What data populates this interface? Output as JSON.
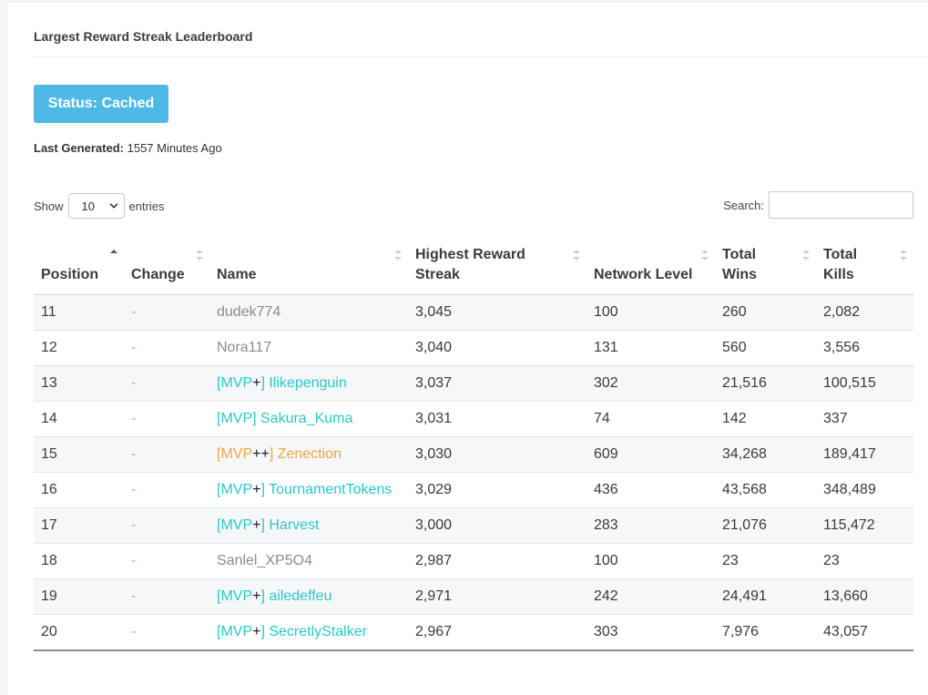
{
  "card": {
    "title": "Largest Reward Streak Leaderboard"
  },
  "status": {
    "label": "Status: Cached"
  },
  "last_generated": {
    "label": "Last Generated:",
    "value": "1557 Minutes Ago"
  },
  "length": {
    "show_label": "Show",
    "selected": "10",
    "entries_label": "entries"
  },
  "search": {
    "label": "Search:",
    "value": "",
    "placeholder": ""
  },
  "table": {
    "columns": [
      "Position",
      "Change",
      "Name",
      "Highest Reward Streak",
      "Network Level",
      "Total Wins",
      "Total Kills"
    ],
    "sorted_column": "Position",
    "rows": [
      {
        "position": "11",
        "change": "-",
        "name_parts": [
          {
            "text": "dudek774",
            "color": "gray"
          }
        ],
        "streak": "3,045",
        "level": "100",
        "wins": "260",
        "kills": "2,082"
      },
      {
        "position": "12",
        "change": "-",
        "name_parts": [
          {
            "text": "Nora117",
            "color": "gray"
          }
        ],
        "streak": "3,040",
        "level": "131",
        "wins": "560",
        "kills": "3,556"
      },
      {
        "position": "13",
        "change": "-",
        "name_parts": [
          {
            "text": "[MVP",
            "color": "aqua"
          },
          {
            "text": "+",
            "color": "black"
          },
          {
            "text": "] Ilikepenguin",
            "color": "aqua"
          }
        ],
        "streak": "3,037",
        "level": "302",
        "wins": "21,516",
        "kills": "100,515"
      },
      {
        "position": "14",
        "change": "-",
        "name_parts": [
          {
            "text": "[MVP] Sakura_Kuma",
            "color": "aqua"
          }
        ],
        "streak": "3,031",
        "level": "74",
        "wins": "142",
        "kills": "337"
      },
      {
        "position": "15",
        "change": "-",
        "name_parts": [
          {
            "text": "[MVP",
            "color": "orange"
          },
          {
            "text": "++",
            "color": "black"
          },
          {
            "text": "] Zenection",
            "color": "orange"
          }
        ],
        "streak": "3,030",
        "level": "609",
        "wins": "34,268",
        "kills": "189,417"
      },
      {
        "position": "16",
        "change": "-",
        "name_parts": [
          {
            "text": "[MVP",
            "color": "aqua"
          },
          {
            "text": "+",
            "color": "black"
          },
          {
            "text": "] TournamentTokens",
            "color": "aqua"
          }
        ],
        "streak": "3,029",
        "level": "436",
        "wins": "43,568",
        "kills": "348,489"
      },
      {
        "position": "17",
        "change": "-",
        "name_parts": [
          {
            "text": "[MVP",
            "color": "aqua"
          },
          {
            "text": "+",
            "color": "black"
          },
          {
            "text": "] Harvest",
            "color": "aqua"
          }
        ],
        "streak": "3,000",
        "level": "283",
        "wins": "21,076",
        "kills": "115,472"
      },
      {
        "position": "18",
        "change": "-",
        "name_parts": [
          {
            "text": "Sanlel_XP5O4",
            "color": "gray"
          }
        ],
        "streak": "2,987",
        "level": "100",
        "wins": "23",
        "kills": "23"
      },
      {
        "position": "19",
        "change": "-",
        "name_parts": [
          {
            "text": "[MVP",
            "color": "aqua"
          },
          {
            "text": "+",
            "color": "black"
          },
          {
            "text": "] ailedeffeu",
            "color": "aqua"
          }
        ],
        "streak": "2,971",
        "level": "242",
        "wins": "24,491",
        "kills": "13,660"
      },
      {
        "position": "20",
        "change": "-",
        "name_parts": [
          {
            "text": "[MVP",
            "color": "aqua"
          },
          {
            "text": "+",
            "color": "black"
          },
          {
            "text": "] SecretlyStalker",
            "color": "aqua"
          }
        ],
        "streak": "2,967",
        "level": "303",
        "wins": "7,976",
        "kills": "43,057"
      }
    ]
  },
  "colors": {
    "status_button": "#4fb9e6",
    "gray": "#8c8c8c",
    "aqua": "#28c8c8",
    "orange": "#f0a44b",
    "black": "#1a1a1a"
  }
}
